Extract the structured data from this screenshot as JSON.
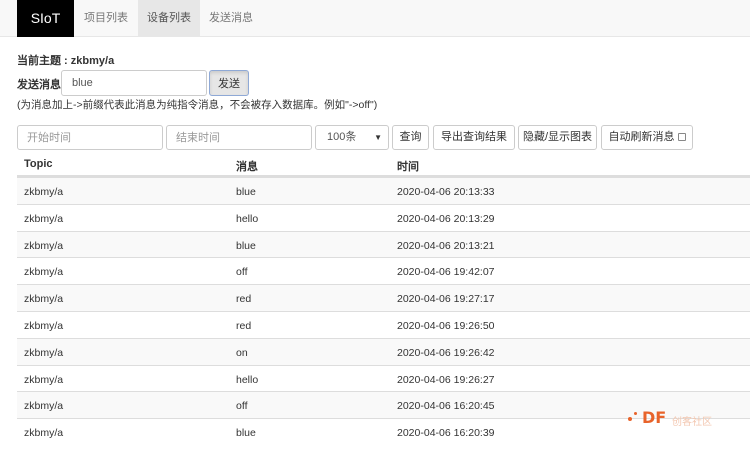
{
  "navbar": {
    "brand": "SIoT",
    "items": [
      {
        "label": "项目列表",
        "active": false
      },
      {
        "label": "设备列表",
        "active": true
      },
      {
        "label": "发送消息",
        "active": false
      }
    ]
  },
  "topic": {
    "label": "当前主题 : ",
    "value": "zkbmy/a"
  },
  "send": {
    "label": "发送消息",
    "input_value": "blue",
    "button_label": "发送",
    "hint": "(为消息加上->前缀代表此消息为纯指令消息，不会被存入数据库。例如\"->off\")"
  },
  "filters": {
    "start_placeholder": "开始时间",
    "end_placeholder": "结束时间",
    "limit_value": "100条",
    "query_button": "查询",
    "export_button": "导出查询结果",
    "toggle_chart_button": "隐藏/显示图表",
    "auto_refresh_label": "自动刷新消息"
  },
  "table": {
    "headers": [
      "Topic",
      "消息",
      "时间"
    ],
    "rows": [
      [
        "zkbmy/a",
        "blue",
        "2020-04-06 20:13:33"
      ],
      [
        "zkbmy/a",
        "hello",
        "2020-04-06 20:13:29"
      ],
      [
        "zkbmy/a",
        "blue",
        "2020-04-06 20:13:21"
      ],
      [
        "zkbmy/a",
        "off",
        "2020-04-06 19:42:07"
      ],
      [
        "zkbmy/a",
        "red",
        "2020-04-06 19:27:17"
      ],
      [
        "zkbmy/a",
        "red",
        "2020-04-06 19:26:50"
      ],
      [
        "zkbmy/a",
        "on",
        "2020-04-06 19:26:42"
      ],
      [
        "zkbmy/a",
        "hello",
        "2020-04-06 19:26:27"
      ],
      [
        "zkbmy/a",
        "off",
        "2020-04-06 16:20:45"
      ],
      [
        "zkbmy/a",
        "blue",
        "2020-04-06 16:20:39"
      ]
    ]
  },
  "watermark": {
    "logo_text": "DF",
    "text": "创客社区",
    "color": "#e8632a"
  }
}
